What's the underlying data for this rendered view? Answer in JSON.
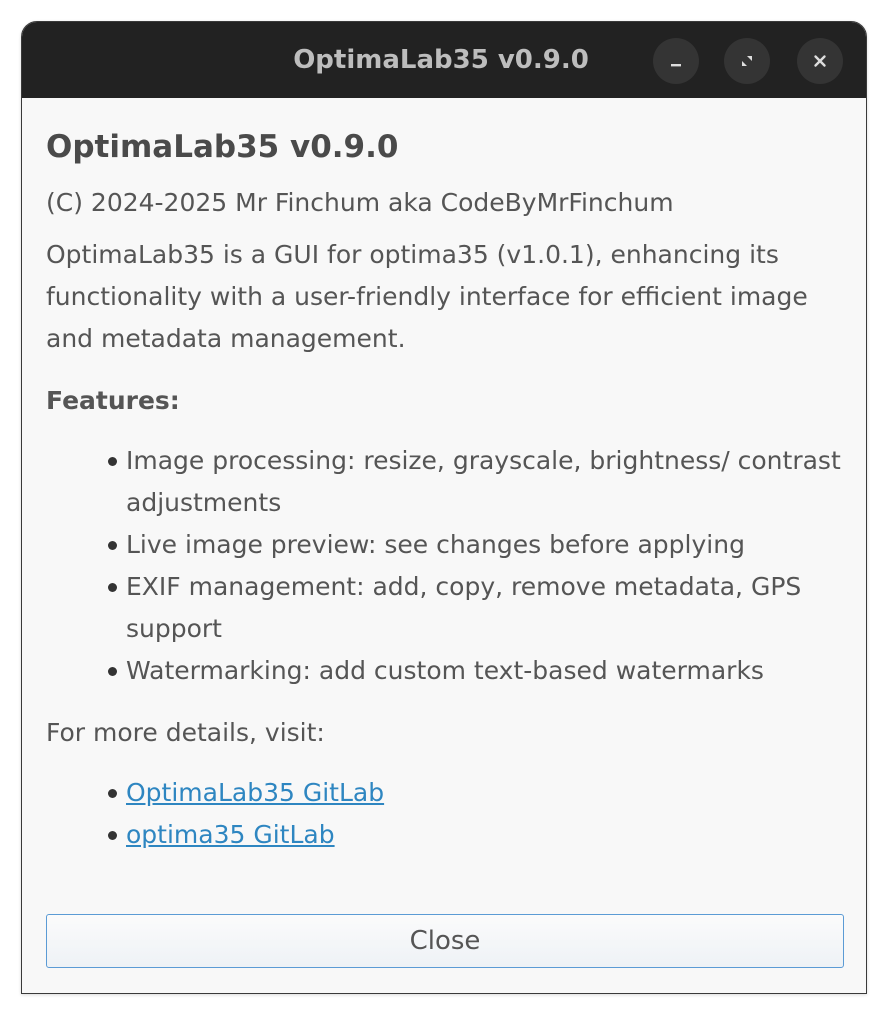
{
  "window": {
    "title": "OptimaLab35 v0.9.0"
  },
  "titlebar_buttons": {
    "minimize_icon": "minimize-icon",
    "maximize_icon": "maximize-icon",
    "close_icon": "close-icon"
  },
  "about": {
    "heading": "OptimaLab35 v0.9.0",
    "copyright": "(C) 2024-2025 Mr Finchum aka CodeByMrFinchum",
    "description": "OptimaLab35 is a GUI for optima35 (v1.0.1), enhancing its functionality with a user-friendly interface for efficient image and metadata management.",
    "features_heading": "Features:",
    "features": [
      "Image processing: resize, grayscale, brightness/ contrast adjustments",
      "Live image preview: see changes before applying",
      "EXIF management: add, copy, remove metadata, GPS support",
      "Watermarking: add custom text-based watermarks"
    ],
    "more_details": "For more details, visit:",
    "links": [
      "OptimaLab35 GitLab",
      "optima35 GitLab"
    ]
  },
  "dialog": {
    "close_label": "Close"
  },
  "colors": {
    "titlebar": "#222222",
    "link": "#2e86c1",
    "button_border": "#5b9bd5"
  }
}
